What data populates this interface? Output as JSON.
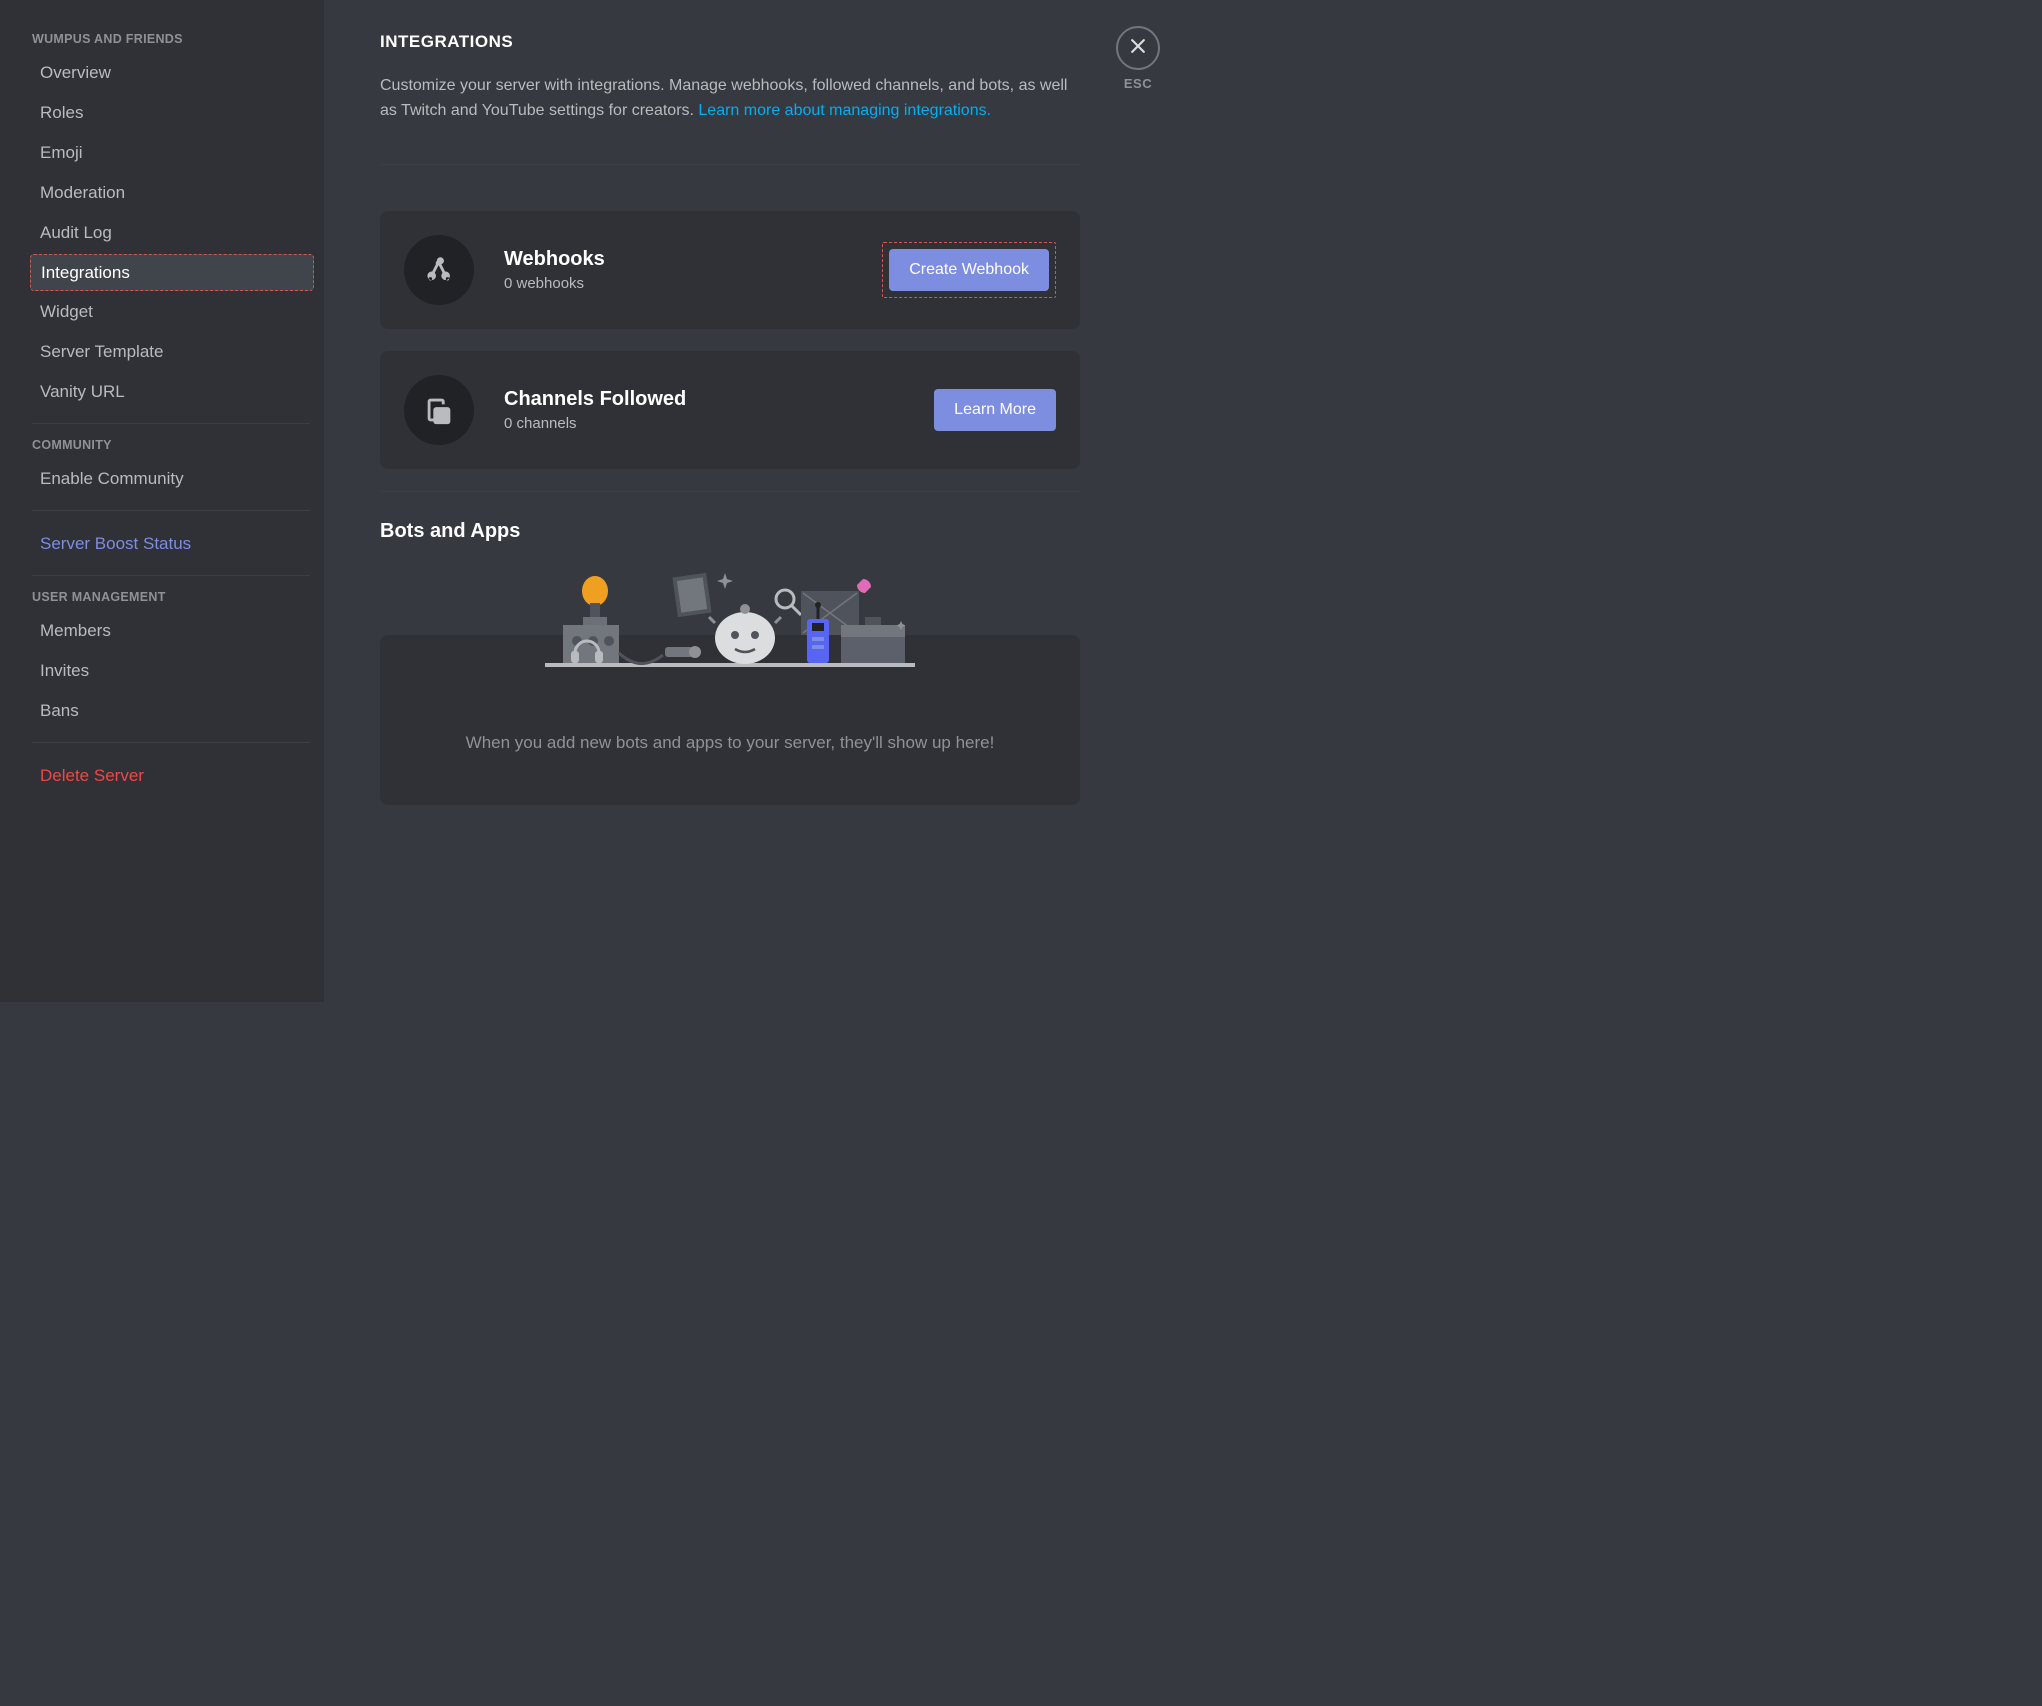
{
  "sidebar": {
    "section_server_label": "WUMPUS AND FRIENDS",
    "items_server": [
      {
        "label": "Overview"
      },
      {
        "label": "Roles"
      },
      {
        "label": "Emoji"
      },
      {
        "label": "Moderation"
      },
      {
        "label": "Audit Log"
      },
      {
        "label": "Integrations"
      },
      {
        "label": "Widget"
      },
      {
        "label": "Server Template"
      },
      {
        "label": "Vanity URL"
      }
    ],
    "section_community_label": "COMMUNITY",
    "enable_community_label": "Enable Community",
    "server_boost_label": "Server Boost Status",
    "section_user_mgmt_label": "USER MANAGEMENT",
    "items_user": [
      {
        "label": "Members"
      },
      {
        "label": "Invites"
      },
      {
        "label": "Bans"
      }
    ],
    "delete_server_label": "Delete Server"
  },
  "main": {
    "title": "INTEGRATIONS",
    "desc_text": "Customize your server with integrations. Manage webhooks, followed channels, and bots, as well as Twitch and YouTube settings for creators. ",
    "desc_link": "Learn more about managing integrations.",
    "webhooks": {
      "title": "Webhooks",
      "sub": "0 webhooks",
      "button": "Create Webhook"
    },
    "channels_followed": {
      "title": "Channels Followed",
      "sub": "0 channels",
      "button": "Learn More"
    },
    "bots_section_title": "Bots and Apps",
    "bots_empty_text": "When you add new bots and apps to your server, they'll show up here!"
  },
  "close": {
    "label": "ESC"
  }
}
